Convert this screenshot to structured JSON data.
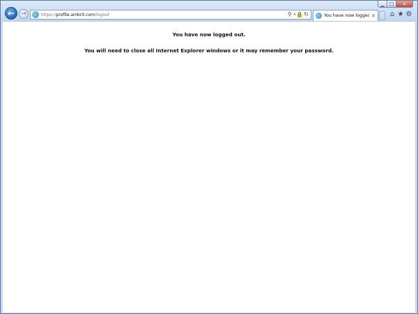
{
  "window": {
    "caption": {
      "minimize": "▁",
      "maximize": "□",
      "close": "✕"
    }
  },
  "nav": {
    "back_icon": "←",
    "forward_icon": "→"
  },
  "address_bar": {
    "url_prefix": "https://",
    "url_domain": "profile.ambrit.com",
    "url_path": "/logout",
    "search_icon": "⚲",
    "dropdown_icon": "▾",
    "refresh_icon": "↻"
  },
  "tab": {
    "title": "You have now logged ...",
    "close": "✕"
  },
  "toolbar": {
    "home_icon": "⌂",
    "favorites_icon": "★",
    "tools_icon": "⚙"
  },
  "content": {
    "message_1": "You have now logged out.",
    "message_2": "You will need to close all Internet Explorer windows or it may remember your password."
  }
}
